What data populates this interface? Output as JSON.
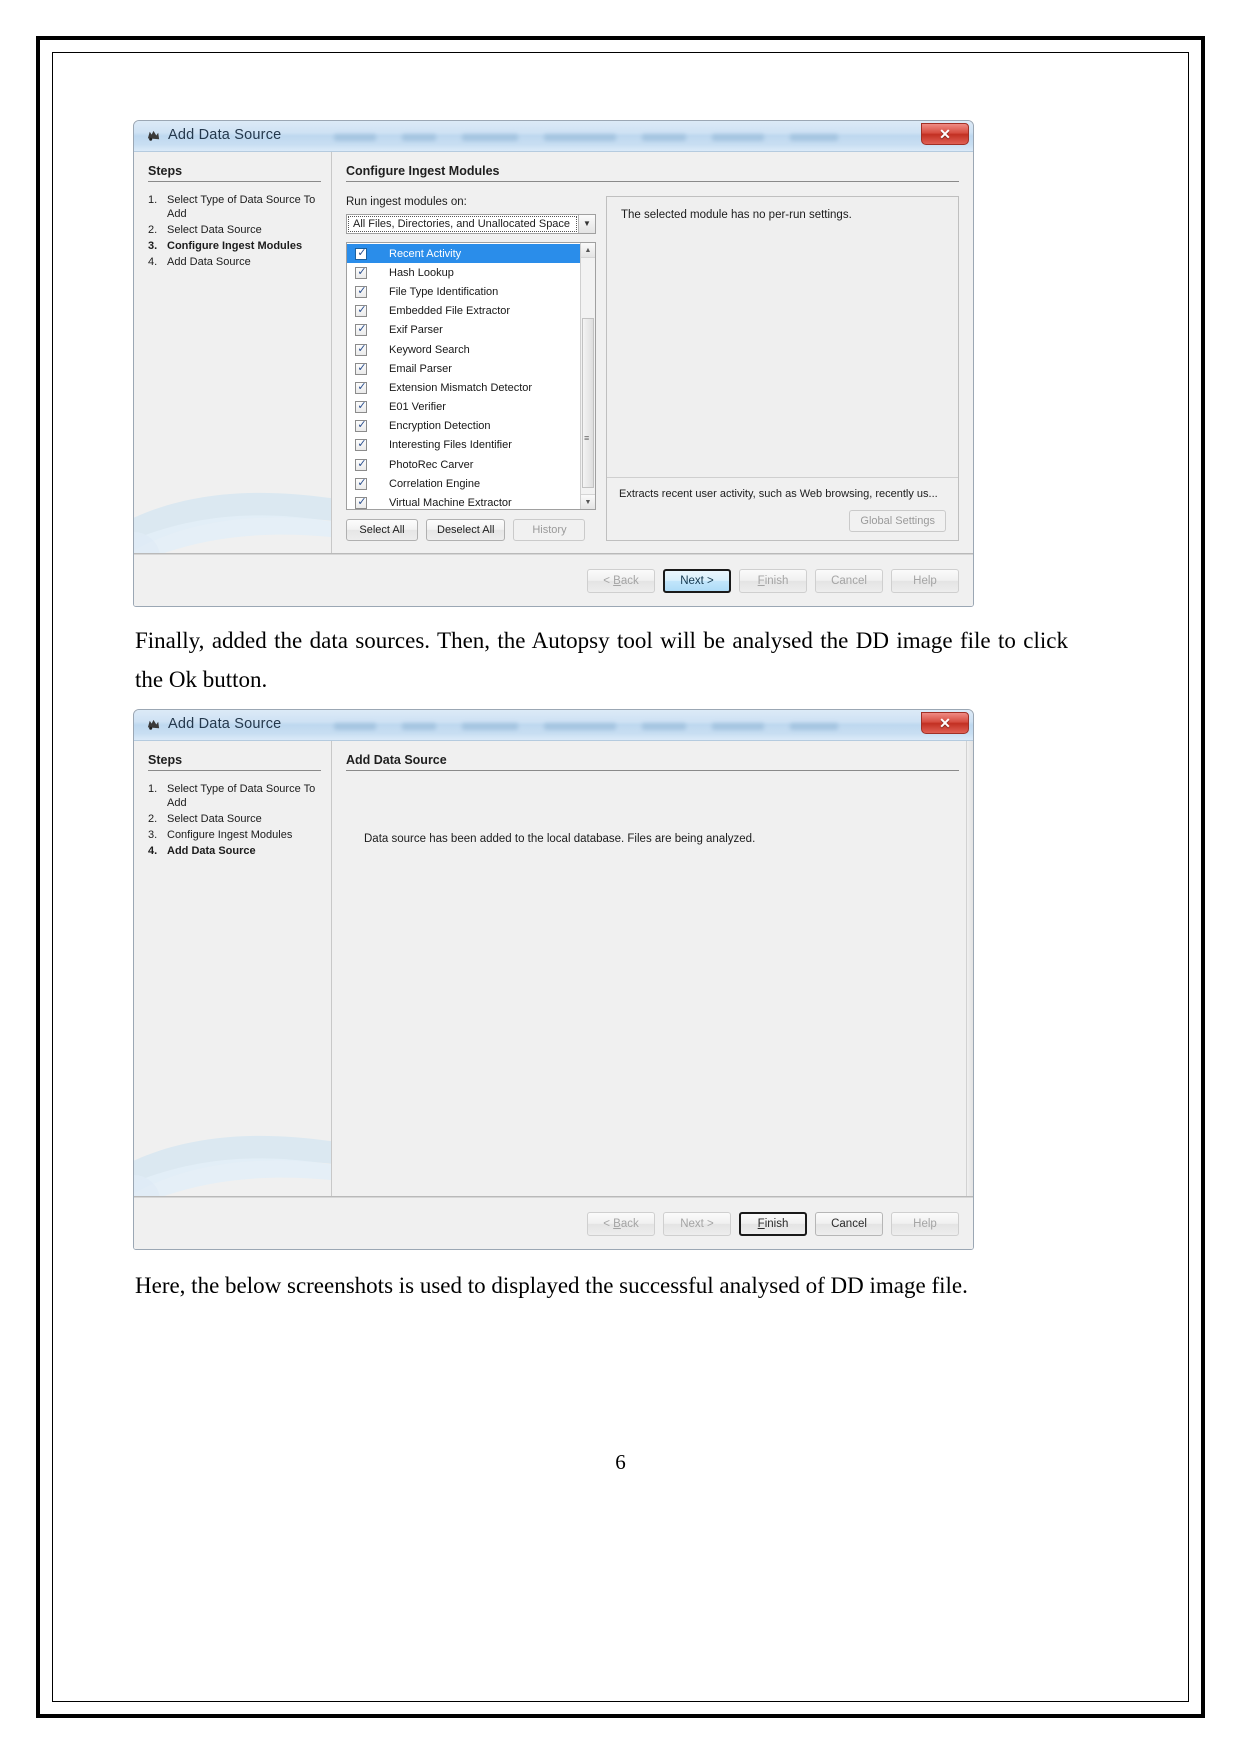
{
  "document": {
    "page_number": "6",
    "paragraph_1": "Finally, added the data sources. Then, the Autopsy tool will be analysed the DD image file to click the Ok button.",
    "paragraph_2": "Here, the below screenshots is used to displayed the successful analysed of DD image file."
  },
  "dialog1": {
    "window_title": "Add Data Source",
    "title_icon": "autopsy-app-icon",
    "close_label": "✕",
    "steps_heading": "Steps",
    "steps": [
      {
        "num": "1.",
        "label": "Select Type of Data Source To Add",
        "active": false
      },
      {
        "num": "2.",
        "label": "Select Data Source",
        "active": false
      },
      {
        "num": "3.",
        "label": "Configure Ingest Modules",
        "active": true
      },
      {
        "num": "4.",
        "label": "Add Data Source",
        "active": false
      }
    ],
    "pane_title": "Configure Ingest Modules",
    "run_label": "Run ingest modules on:",
    "combo_value": "All Files, Directories, and Unallocated Space",
    "modules": [
      {
        "name": "Recent Activity",
        "checked": true,
        "selected": true
      },
      {
        "name": "Hash Lookup",
        "checked": true,
        "selected": false
      },
      {
        "name": "File Type Identification",
        "checked": true,
        "selected": false
      },
      {
        "name": "Embedded File Extractor",
        "checked": true,
        "selected": false
      },
      {
        "name": "Exif Parser",
        "checked": true,
        "selected": false
      },
      {
        "name": "Keyword Search",
        "checked": true,
        "selected": false
      },
      {
        "name": "Email Parser",
        "checked": true,
        "selected": false
      },
      {
        "name": "Extension Mismatch Detector",
        "checked": true,
        "selected": false
      },
      {
        "name": "E01 Verifier",
        "checked": true,
        "selected": false
      },
      {
        "name": "Encryption Detection",
        "checked": true,
        "selected": false
      },
      {
        "name": "Interesting Files Identifier",
        "checked": true,
        "selected": false
      },
      {
        "name": "PhotoRec Carver",
        "checked": true,
        "selected": false
      },
      {
        "name": "Correlation Engine",
        "checked": true,
        "selected": false
      },
      {
        "name": "Virtual Machine Extractor",
        "checked": true,
        "selected": false
      }
    ],
    "select_all_label": "Select All",
    "deselect_all_label": "Deselect All",
    "history_label": "History",
    "settings_message": "The selected module has no per-run settings.",
    "module_description": "Extracts recent user activity, such as Web browsing, recently us...",
    "global_settings_label": "Global Settings",
    "footer": {
      "back_label": "< Back",
      "next_label": "Next >",
      "finish_label": "Finish",
      "cancel_label": "Cancel",
      "help_label": "Help"
    }
  },
  "dialog2": {
    "window_title": "Add Data Source",
    "title_icon": "autopsy-app-icon",
    "close_label": "✕",
    "steps_heading": "Steps",
    "steps": [
      {
        "num": "1.",
        "label": "Select Type of Data Source To Add",
        "active": false
      },
      {
        "num": "2.",
        "label": "Select Data Source",
        "active": false
      },
      {
        "num": "3.",
        "label": "Configure Ingest Modules",
        "active": false
      },
      {
        "num": "4.",
        "label": "Add Data Source",
        "active": true
      }
    ],
    "pane_title": "Add Data Source",
    "status_message": "Data source has been added to the local database. Files are being analyzed.",
    "footer": {
      "back_label": "< Back",
      "next_label": "Next >",
      "finish_label": "Finish",
      "cancel_label": "Cancel",
      "help_label": "Help"
    }
  },
  "colors": {
    "selection_blue": "#2a8dea",
    "title_gradient_top": "#dceaf7",
    "close_red": "#d64c40",
    "default_button_blue": "#3c7fb1"
  }
}
